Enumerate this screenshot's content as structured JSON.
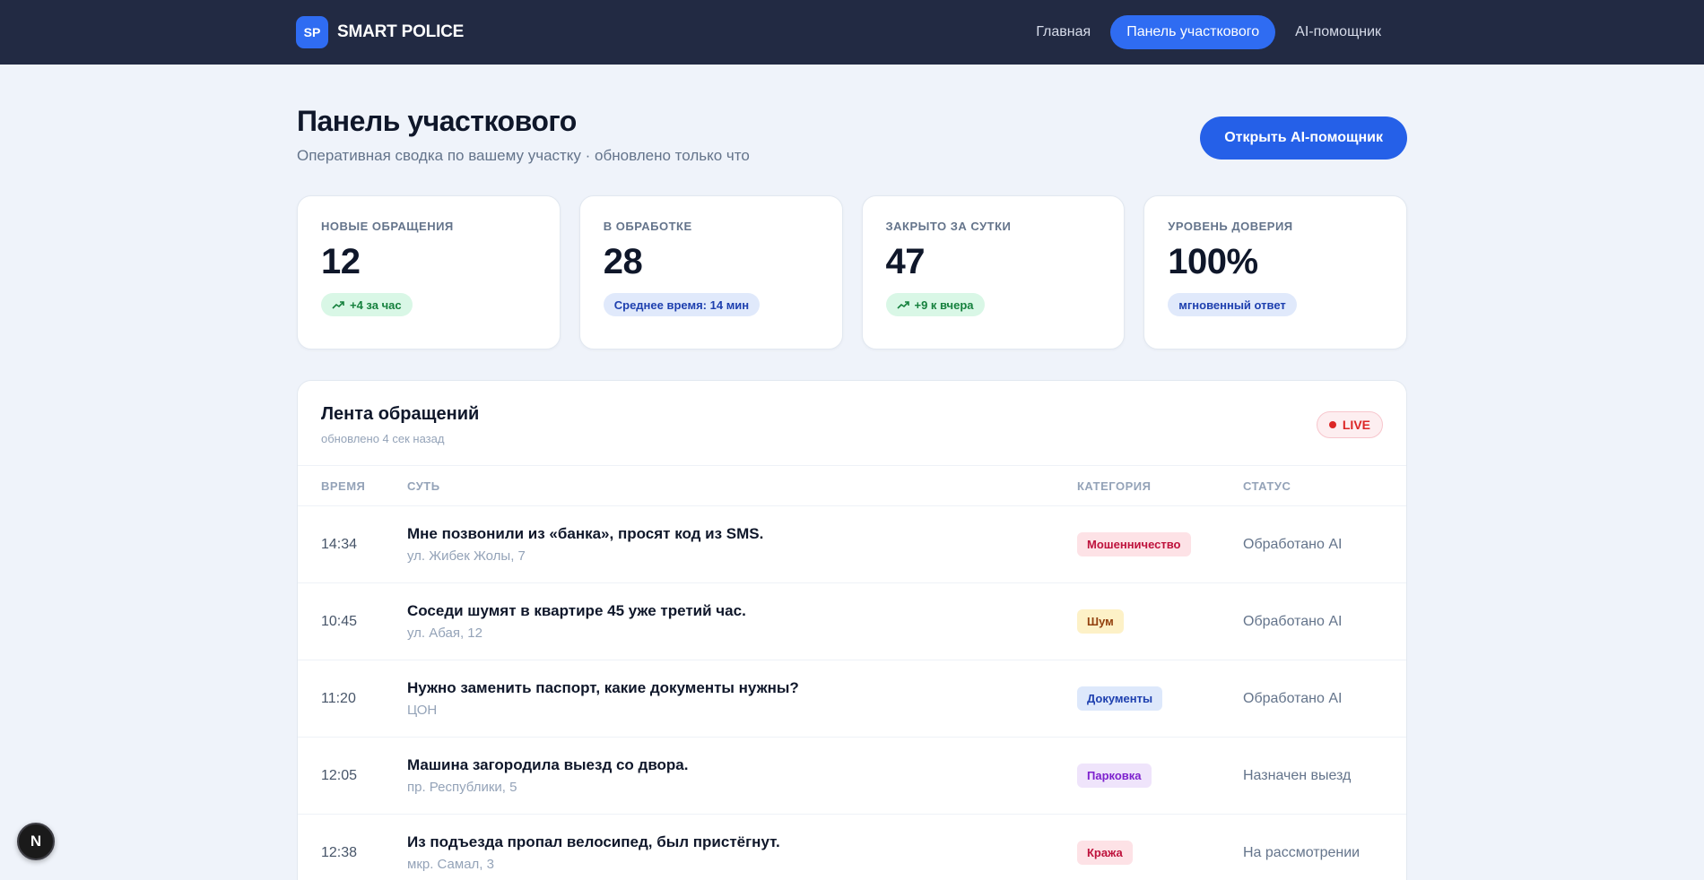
{
  "brand": {
    "badge": "SP",
    "name": "SMART POLICE"
  },
  "nav": [
    {
      "label": "Главная",
      "active": false
    },
    {
      "label": "Панель участкового",
      "active": true
    },
    {
      "label": "AI-помощник",
      "active": false
    }
  ],
  "page": {
    "title": "Панель участкового",
    "subtitle": "Оперативная сводка по вашему участку · обновлено только что",
    "cta": "Открыть AI-помощник"
  },
  "stats": [
    {
      "label": "НОВЫЕ ОБРАЩЕНИЯ",
      "value": "12",
      "pill": "+4 за час",
      "pill_color": "green",
      "trend": true
    },
    {
      "label": "В ОБРАБОТКЕ",
      "value": "28",
      "pill": "Среднее время: 14 мин",
      "pill_color": "blue",
      "trend": false
    },
    {
      "label": "ЗАКРЫТО ЗА СУТКИ",
      "value": "47",
      "pill": "+9 к вчера",
      "pill_color": "green",
      "trend": true
    },
    {
      "label": "УРОВЕНЬ ДОВЕРИЯ",
      "value": "100%",
      "pill": "мгновенный ответ",
      "pill_color": "blue",
      "trend": false
    }
  ],
  "feed": {
    "title": "Лента обращений",
    "updated": "обновлено 4 сек назад",
    "live": "LIVE",
    "columns": {
      "time": "ВРЕМЯ",
      "gist": "СУТЬ",
      "category": "КАТЕГОРИЯ",
      "status": "СТАТУС"
    },
    "rows": [
      {
        "time": "14:34",
        "text": "Мне позвонили из «банка», просят код из SMS.",
        "address": "ул. Жибек Жолы, 7",
        "category": "Мошенничество",
        "cat_bg": "#fde2e6",
        "cat_fg": "#be123c",
        "status": "Обработано AI"
      },
      {
        "time": "10:45",
        "text": "Соседи шумят в квартире 45 уже третий час.",
        "address": "ул. Абая, 12",
        "category": "Шум",
        "cat_bg": "#fdf1c7",
        "cat_fg": "#92400e",
        "status": "Обработано AI"
      },
      {
        "time": "11:20",
        "text": "Нужно заменить паспорт, какие документы нужны?",
        "address": "ЦОН",
        "category": "Документы",
        "cat_bg": "#dde8fb",
        "cat_fg": "#1e40af",
        "status": "Обработано AI"
      },
      {
        "time": "12:05",
        "text": "Машина загородила выезд со двора.",
        "address": "пр. Республики, 5",
        "category": "Парковка",
        "cat_bg": "#efe4fb",
        "cat_fg": "#7e22ce",
        "status": "Назначен выезд"
      },
      {
        "time": "12:38",
        "text": "Из подъезда пропал велосипед, был пристёгнут.",
        "address": "мкр. Самал, 3",
        "category": "Кража",
        "cat_bg": "#fde2e6",
        "cat_fg": "#be123c",
        "status": "На рассмотрении"
      }
    ]
  },
  "dev_badge": "N"
}
